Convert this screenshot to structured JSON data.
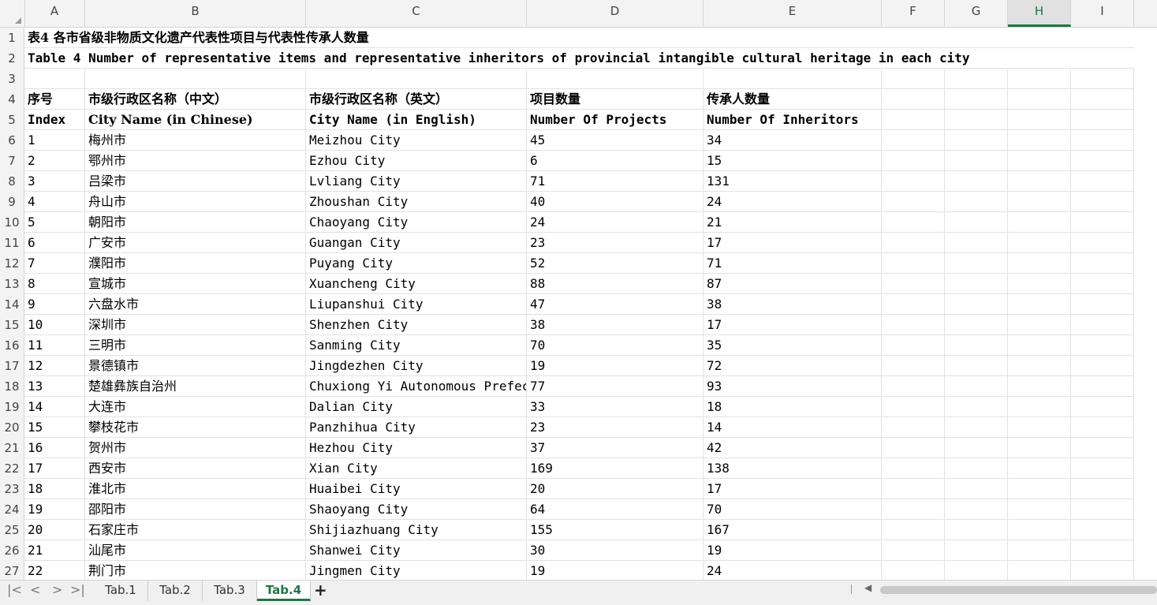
{
  "columns": [
    "A",
    "B",
    "C",
    "D",
    "E",
    "F",
    "G",
    "H",
    "I"
  ],
  "selected_column": "H",
  "rows": [
    {
      "n": "1",
      "cells": [
        "表4 各市省级非物质文化遗产代表性项目与代表性传承人数量",
        "",
        "",
        "",
        ""
      ],
      "bold": true
    },
    {
      "n": "2",
      "cells": [
        "Table 4 Number of representative items and representative inheritors of provincial intangible cultural heritage in each city",
        "",
        "",
        "",
        ""
      ],
      "bold": true
    },
    {
      "n": "3",
      "cells": [
        "",
        "",
        "",
        "",
        ""
      ]
    },
    {
      "n": "4",
      "cells": [
        "序号",
        "市级行政区名称（中文）",
        "市级行政区名称（英文）",
        "项目数量",
        "传承人数量"
      ],
      "bold": true
    },
    {
      "n": "5",
      "cells": [
        "Index",
        "City Name (in Chinese)",
        "City Name (in English)",
        "Number Of Projects",
        "Number Of Inheritors"
      ],
      "bold": true
    },
    {
      "n": "6",
      "cells": [
        "1",
        "梅州市",
        "Meizhou City",
        "45",
        "34"
      ]
    },
    {
      "n": "7",
      "cells": [
        "2",
        "鄂州市",
        "Ezhou City",
        "6",
        "15"
      ]
    },
    {
      "n": "8",
      "cells": [
        "3",
        "吕梁市",
        "Lvliang City",
        "71",
        "131"
      ]
    },
    {
      "n": "9",
      "cells": [
        "4",
        "舟山市",
        "Zhoushan City",
        "40",
        "24"
      ]
    },
    {
      "n": "10",
      "cells": [
        "5",
        "朝阳市",
        "Chaoyang City",
        "24",
        "21"
      ]
    },
    {
      "n": "11",
      "cells": [
        "6",
        "广安市",
        "Guangan City",
        "23",
        "17"
      ]
    },
    {
      "n": "12",
      "cells": [
        "7",
        "濮阳市",
        "Puyang City",
        "52",
        "71"
      ]
    },
    {
      "n": "13",
      "cells": [
        "8",
        "宣城市",
        "Xuancheng City",
        "88",
        "87"
      ]
    },
    {
      "n": "14",
      "cells": [
        "9",
        "六盘水市",
        "Liupanshui City",
        "47",
        "38"
      ]
    },
    {
      "n": "15",
      "cells": [
        "10",
        "深圳市",
        "Shenzhen City",
        "38",
        "17"
      ]
    },
    {
      "n": "16",
      "cells": [
        "11",
        "三明市",
        "Sanming City",
        "70",
        "35"
      ]
    },
    {
      "n": "17",
      "cells": [
        "12",
        "景德镇市",
        "Jingdezhen City",
        "19",
        "72"
      ]
    },
    {
      "n": "18",
      "cells": [
        "13",
        "楚雄彝族自治州",
        "Chuxiong Yi Autonomous Prefecture",
        "77",
        "93"
      ]
    },
    {
      "n": "19",
      "cells": [
        "14",
        "大连市",
        "Dalian City",
        "33",
        "18"
      ]
    },
    {
      "n": "20",
      "cells": [
        "15",
        "攀枝花市",
        "Panzhihua City",
        "23",
        "14"
      ]
    },
    {
      "n": "21",
      "cells": [
        "16",
        "贺州市",
        "Hezhou City",
        "37",
        "42"
      ]
    },
    {
      "n": "22",
      "cells": [
        "17",
        "西安市",
        "Xian City",
        "169",
        "138"
      ]
    },
    {
      "n": "23",
      "cells": [
        "18",
        "淮北市",
        "Huaibei City",
        "20",
        "17"
      ]
    },
    {
      "n": "24",
      "cells": [
        "19",
        "邵阳市",
        "Shaoyang City",
        "64",
        "70"
      ]
    },
    {
      "n": "25",
      "cells": [
        "20",
        "石家庄市",
        "Shijiazhuang City",
        "155",
        "167"
      ]
    },
    {
      "n": "26",
      "cells": [
        "21",
        "汕尾市",
        "Shanwei City",
        "30",
        "19"
      ]
    },
    {
      "n": "27",
      "cells": [
        "22",
        "荆门市",
        "Jingmen City",
        "19",
        "24"
      ]
    }
  ],
  "sheet_tabs": [
    "Tab.1",
    "Tab.2",
    "Tab.3",
    "Tab.4"
  ],
  "active_tab": "Tab.4",
  "add_sheet_label": "+",
  "nav_icons": [
    "first-sheet-icon",
    "prev-sheet-icon",
    "next-sheet-icon",
    "last-sheet-icon"
  ],
  "nav_glyphs": [
    "|<",
    "<",
    ">",
    ">|"
  ],
  "colors": {
    "accent": "#217346",
    "header_bg": "#f3f3f3",
    "grid_line": "#e2e2e2"
  }
}
